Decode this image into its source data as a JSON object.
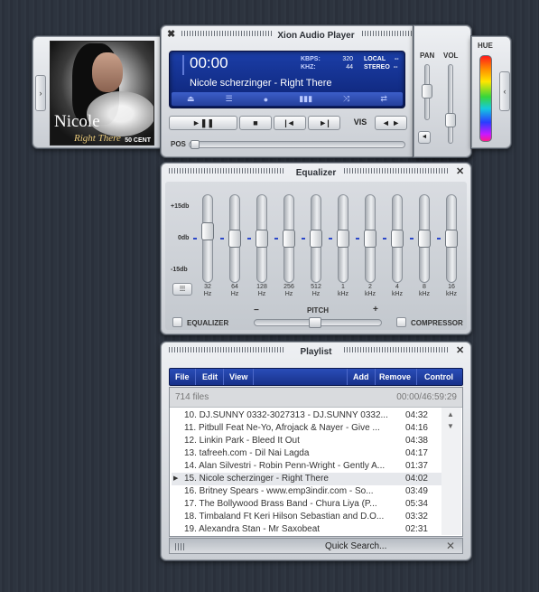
{
  "player": {
    "title": "Xion Audio Player",
    "time": "00:00",
    "kbps_label": "KBPS:",
    "kbps": "320",
    "khz_label": "KHZ:",
    "khz": "44",
    "local": "LOCAL",
    "stereo": "STEREO",
    "flag1": "--",
    "flag2": "--",
    "track": "Nicole scherzinger - Right There",
    "vis_label": "VIS",
    "pos_label": "POS",
    "play_pause": "►❚❚",
    "stop": "■",
    "prev": "|◄",
    "next": "►|",
    "vis_nav": "◄ ►",
    "mini_toggle": "◄",
    "icons": [
      "eject-icon",
      "playlist-icon",
      "record-icon",
      "equalizer-icon",
      "shuffle-icon",
      "repeat-icon"
    ],
    "accent": "#1b3ea8"
  },
  "album_art": {
    "line1": "Nicole",
    "line2": "Right There",
    "line3": "50 CENT"
  },
  "side": {
    "pan_label": "PAN",
    "vol_label": "VOL",
    "hue_label": "HUE"
  },
  "equalizer": {
    "title": "Equalizer",
    "db_labels": [
      "+15db",
      "0db",
      "-15db"
    ],
    "bands": [
      {
        "f": "32",
        "u": "Hz"
      },
      {
        "f": "64",
        "u": "Hz"
      },
      {
        "f": "128",
        "u": "Hz"
      },
      {
        "f": "256",
        "u": "Hz"
      },
      {
        "f": "512",
        "u": "Hz"
      },
      {
        "f": "1",
        "u": "kHz"
      },
      {
        "f": "2",
        "u": "kHz"
      },
      {
        "f": "4",
        "u": "kHz"
      },
      {
        "f": "8",
        "u": "kHz"
      },
      {
        "f": "16",
        "u": "kHz"
      }
    ],
    "band_levels": [
      0.22,
      0,
      0,
      0,
      0,
      0,
      0,
      0,
      0,
      0
    ],
    "pitch_label": "PITCH",
    "pitch_minus": "−",
    "pitch_plus": "+",
    "equalizer_label": "EQUALIZER",
    "compressor_label": "COMPRESSOR"
  },
  "playlist": {
    "title": "Playlist",
    "menu": [
      "File",
      "Edit",
      "View",
      "Add",
      "Remove",
      "Control"
    ],
    "file_count": "714 files",
    "total_time": "00:00/46:59:29",
    "items": [
      {
        "name": "10. DJ.SUNNY 0332-3027313 - DJ.SUNNY 0332...",
        "dur": "04:32"
      },
      {
        "name": "11. Pitbull Feat Ne-Yo, Afrojack & Nayer - Give ...",
        "dur": "04:16"
      },
      {
        "name": "12. Linkin Park - Bleed It Out",
        "dur": "04:38"
      },
      {
        "name": "13. tafreeh.com - Dil Nai Lagda",
        "dur": "04:17"
      },
      {
        "name": "14. Alan Silvestri - Robin Penn-Wright - Gently A...",
        "dur": "01:37"
      },
      {
        "name": "15. Nicole scherzinger - Right There",
        "dur": "04:02"
      },
      {
        "name": "16. Britney Spears - www.emp3indir.com - So...",
        "dur": "03:49"
      },
      {
        "name": "17. The Bollywood Brass Band - Chura Liya (P...",
        "dur": "05:34"
      },
      {
        "name": "18. Timbaland Ft Keri Hilson Sebastian and D.O...",
        "dur": "03:32"
      },
      {
        "name": "19. Alexandra Stan - Mr Saxobeat",
        "dur": "02:31"
      }
    ],
    "selected_index": 5,
    "search_label": "Quick Search...",
    "close": "✕"
  }
}
